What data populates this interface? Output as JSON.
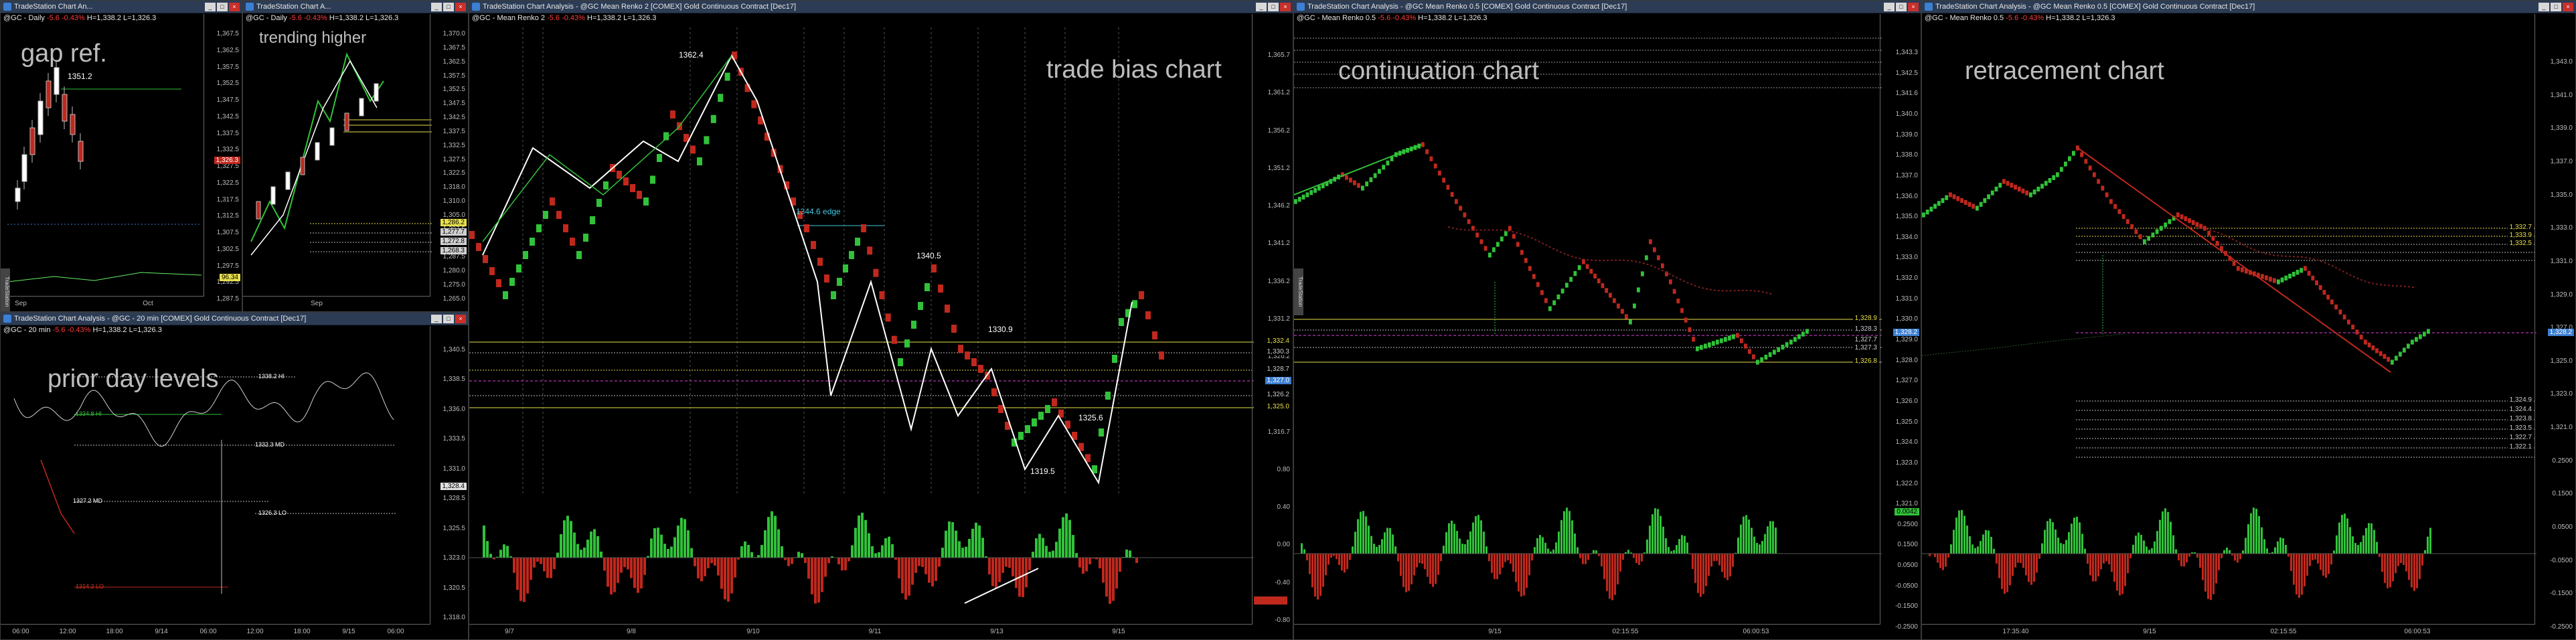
{
  "windows": {
    "gap": {
      "title": "TradeStation Chart An...",
      "symbol": "@GC - Daily",
      "change": "-5.6 -0.43%",
      "hilo": "H=1,338.2  L=1,326.3",
      "big_text": "gap ref.",
      "level_label": "1351.2",
      "price_ticks": [
        "1,367.5",
        "1,362.5",
        "1,357.5",
        "1,352.5",
        "1,347.5",
        "1,342.5",
        "1,337.5",
        "1,332.5",
        "1,327.5",
        "1,322.5",
        "1,317.5",
        "1,312.5",
        "1,307.5",
        "1,302.5",
        "1,297.5",
        "1,292.5",
        "1,287.5"
      ],
      "date_ticks": [
        "Sep",
        "Oct"
      ],
      "level_price": "1,305.3",
      "last_price": "1,326.3",
      "bottom_tag": "96.34"
    },
    "trend": {
      "title": "TradeStation Chart A...",
      "symbol": "@GC - Daily",
      "change": "-5.6 -0.43%",
      "hilo": "H=1,338.2  L=1,326.3",
      "big_text": "trending higher",
      "price_ticks": [
        "1,370.0",
        "1,367.5",
        "1,362.5",
        "1,357.5",
        "1,352.5",
        "1,347.5",
        "1,342.5",
        "1,337.5",
        "1,332.5",
        "1,327.5",
        "1,322.5",
        "1,318.0",
        "1,310.0",
        "1,305.0",
        "1,297.5",
        "1,292.5",
        "1,287.5",
        "1,280.0",
        "1,275.0",
        "1,265.0"
      ],
      "date_ticks": [
        "Sep"
      ],
      "levels": [
        "1,286.2",
        "1,277.7",
        "1,272.8",
        "1,268.3"
      ]
    },
    "prior": {
      "title": "TradeStation Chart Analysis - @GC - 20 min [COMEX] Gold Continuous Contract [Dec17]",
      "symbol": "@GC - 20 min",
      "change": "-5.6 -0.43%",
      "hilo": "H=1,338.2  L=1,326.3",
      "big_text": "prior day levels",
      "levels": {
        "hi": "1338.2 HI",
        "green": "1334.8 HI",
        "mid": "1332.3 MD",
        "lo2": "1327.2 MD",
        "lo": "1326.3 LO",
        "red": "1314.2 LO"
      },
      "price_ticks": [
        "1,340.5",
        "1,338.5",
        "1,336.0",
        "1,333.5",
        "1,331.0",
        "1,328.5",
        "1,325.5",
        "1,323.0",
        "1,320.5",
        "1,318.0"
      ],
      "date_ticks": [
        "06:00",
        "12:00",
        "18:00",
        "9/14",
        "06:00",
        "12:00",
        "18:00",
        "9/15",
        "06:00"
      ],
      "last_price": "1,328.4"
    },
    "bias": {
      "title": "TradeStation Chart Analysis - @GC Mean Renko 2 [COMEX] Gold Continuous Contract [Dec17]",
      "symbol": "@GC - Mean Renko 2",
      "change": "-5.6 -0.43%",
      "hilo": "H=1,338.2  L=1,326.3",
      "big_text": "trade bias chart",
      "labels": {
        "top": "1362.4",
        "edge": "1344.6 edge",
        "mid": "1340.5",
        "l1": "1330.9",
        "l2": "1325.6",
        "low": "1319.5"
      },
      "price_ticks": [
        "1,365.7",
        "1,361.2",
        "1,356.2",
        "1,351.2",
        "1,346.2",
        "1,341.2",
        "1,336.2",
        "1,331.2",
        "1,326.2",
        "1,321.2",
        "1,316.7",
        "0.80",
        "0.40",
        "0.00",
        "-0.40",
        "-0.80"
      ],
      "right_tags": [
        "1,332.4",
        "1,330.3",
        "1,328.7",
        "1,326.2",
        "1,325.0"
      ],
      "date_ticks": [
        "9/7",
        "9/8",
        "9/10",
        "9/11",
        "9/13",
        "9/15"
      ],
      "last_price": "1,327.0"
    },
    "cont": {
      "title": "TradeStation Chart Analysis - @GC Mean Renko 0.5 [COMEX] Gold Continuous Contract [Dec17]",
      "symbol": "@GC - Mean Renko 0.5",
      "change": "-5.6 -0.43%",
      "hilo": "H=1,338.2  L=1,326.3",
      "big_text": "continuation chart",
      "price_ticks": [
        "1,343.3",
        "1,342.5",
        "1,341.6",
        "1,340.0",
        "1,339.0",
        "1,338.0",
        "1,337.0",
        "1,336.0",
        "1,335.0",
        "1,334.0",
        "1,333.0",
        "1,332.0",
        "1,331.0",
        "1,330.0",
        "1,329.0",
        "1,328.0",
        "1,327.0",
        "1,326.0",
        "1,325.0",
        "1,324.0",
        "1,323.0",
        "1,322.0",
        "1,321.0",
        "0.2500",
        "0.1500",
        "0.0500",
        "-0.0500",
        "-0.1500",
        "-0.2500"
      ],
      "right_tags": [
        "1,328.9",
        "1,328.3",
        "1,327.7",
        "1,327.3",
        "1,326.8"
      ],
      "date_ticks": [
        "9/15",
        "02:15:55",
        "06:00:53"
      ],
      "last_price": "1,328.2",
      "osc_value": "0.0042"
    },
    "retr": {
      "title": "TradeStation Chart Analysis - @GC Mean Renko 0.5 [COMEX] Gold Continuous Contract [Dec17]",
      "symbol": "@GC - Mean Renko 0.5",
      "change": "-5.6 -0.43%",
      "hilo": "H=1,338.2  L=1,326.3",
      "big_text": "retracement chart",
      "price_ticks": [
        "1,343.0",
        "1,341.0",
        "1,339.0",
        "1,337.0",
        "1,335.0",
        "1,333.0",
        "1,331.0",
        "1,329.0",
        "1,327.0",
        "1,325.0",
        "1,323.0",
        "1,321.0",
        "0.2500",
        "0.1500",
        "0.0500",
        "-0.0500",
        "-0.1500",
        "-0.2500"
      ],
      "right_tags": [
        "1,332.7",
        "1,333.9",
        "1,332.5",
        "1,324.9",
        "1,324.4",
        "1,323.8",
        "1,323.5",
        "1,322.7",
        "1,322.1"
      ],
      "date_ticks": [
        "17:35:40",
        "9/15",
        "02:15:55",
        "06:00:53"
      ],
      "last_price": "1,328.2"
    }
  },
  "colors": {
    "up": "#31c23a",
    "down": "#c0281d",
    "accent": "#3ec7e0",
    "yellow": "#e8e04a",
    "magenta": "#e040e0",
    "titlebar": "#2c3c55"
  }
}
